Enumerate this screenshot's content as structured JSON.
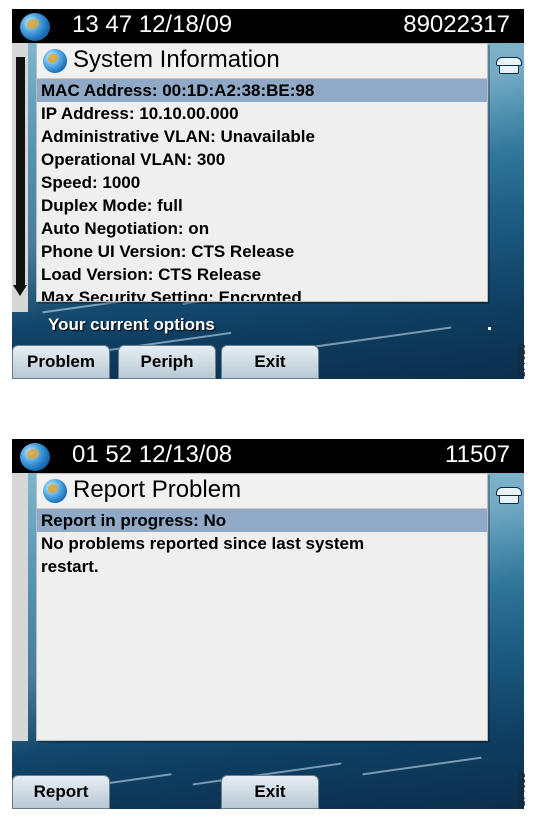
{
  "top_screen": {
    "header": {
      "time_date": "13 47 12/18/09",
      "extension": "89022317"
    },
    "dialog": {
      "title": "System Information",
      "lines": [
        "MAC Address: 00:1D:A2:38:BE:98",
        "IP Address: 10.10.00.000",
        "Administrative VLAN: Unavailable",
        "Operational VLAN: 300",
        "Speed: 1000",
        "Duplex Mode: full",
        "Auto Negotiation: on",
        "Phone UI Version: CTS Release",
        "Load Version: CTS Release",
        "Max Security Setting: Encrypted"
      ],
      "selected_index": 0
    },
    "options_label": "Your current options",
    "softkeys": [
      "Problem",
      "Periph",
      "Exit"
    ],
    "figure_id": "277920"
  },
  "bottom_screen": {
    "header": {
      "time_date": "01 52 12/13/08",
      "extension": "11507"
    },
    "dialog": {
      "title": "Report Problem",
      "lines": [
        "Report in progress: No",
        "No problems reported since last system",
        "restart."
      ],
      "selected_index": 0
    },
    "softkeys": [
      "Report",
      "Exit"
    ],
    "figure_id": "274653"
  },
  "colors": {
    "selection": "#8fa9c6",
    "header_bg": "#000000",
    "dialog_bg": "#efefef"
  },
  "icons": {
    "status": "globe-icon",
    "line": "phone-icon",
    "scroll": "scroll-down-arrow-icon"
  }
}
